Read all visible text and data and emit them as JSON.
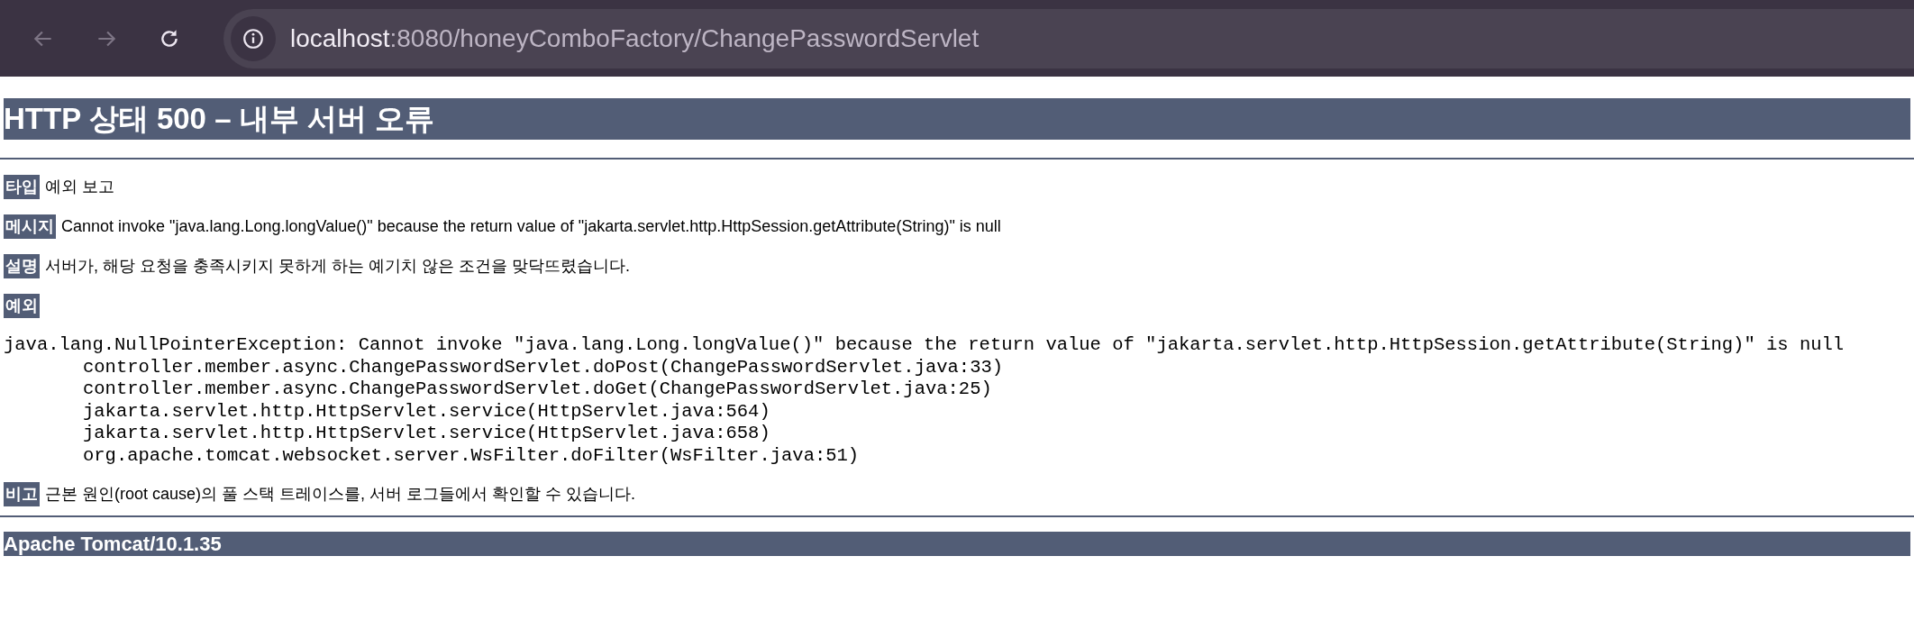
{
  "browser": {
    "nav_buttons": [
      {
        "kind": "back",
        "disabled": true
      },
      {
        "kind": "forward",
        "disabled": true
      },
      {
        "kind": "reload",
        "disabled": false
      }
    ],
    "url_host": "localhost",
    "url_path": ":8080/honeyComboFactory/ChangePasswordServlet"
  },
  "page": {
    "title": "HTTP 상태 500 – 내부 서버 오류",
    "fields": [
      {
        "label": "타입",
        "text": "예외 보고"
      },
      {
        "label": "메시지",
        "text": "Cannot invoke \"java.lang.Long.longValue()\" because the return value of \"jakarta.servlet.http.HttpSession.getAttribute(String)\" is null"
      },
      {
        "label": "설명",
        "text": "서버가, 해당 요청을 충족시키지 못하게 하는 예기치 않은 조건을 맞닥뜨렸습니다."
      }
    ],
    "exception_label": "예외",
    "exception": "java.lang.NullPointerException: Cannot invoke \"java.lang.Long.longValue()\" because the return value of \"jakarta.servlet.http.HttpSession.getAttribute(String)\" is null",
    "frames": [
      "controller.member.async.ChangePasswordServlet.doPost(ChangePasswordServlet.java:33)",
      "controller.member.async.ChangePasswordServlet.doGet(ChangePasswordServlet.java:25)",
      "jakarta.servlet.http.HttpServlet.service(HttpServlet.java:564)",
      "jakarta.servlet.http.HttpServlet.service(HttpServlet.java:658)",
      "org.apache.tomcat.websocket.server.WsFilter.doFilter(WsFilter.java:51)"
    ],
    "note": {
      "label": "비고",
      "text": "근본 원인(root cause)의 풀 스택 트레이스를, 서버 로그들에서 확인할 수 있습니다."
    },
    "footer": "Apache Tomcat/10.1.35"
  }
}
